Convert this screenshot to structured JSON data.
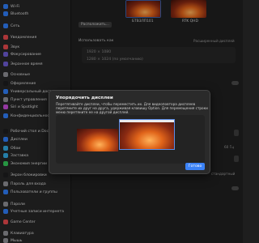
{
  "sidebar": {
    "items": [
      {
        "label": "Wi-Fi",
        "color": "#2f7cf6"
      },
      {
        "label": "Bluetooth",
        "color": "#2f7cf6"
      },
      {
        "label": "Сеть",
        "color": "#2f7cf6"
      },
      {
        "label": "Уведомления",
        "color": "#e5484d"
      },
      {
        "label": "Звук",
        "color": "#e5484d"
      },
      {
        "label": "Фокусирование",
        "color": "#6d5bd0"
      },
      {
        "label": "Экранное время",
        "color": "#6d5bd0"
      },
      {
        "label": "Основные",
        "color": "#8e8e93"
      },
      {
        "label": "Оформление",
        "color": "#1c1c1e"
      },
      {
        "label": "Универсальный доступ",
        "color": "#2f7cf6"
      },
      {
        "label": "Пункт управления",
        "color": "#8e8e93"
      },
      {
        "label": "Siri и Spotlight",
        "color": "#c64bd8"
      },
      {
        "label": "Конфиденциальность",
        "color": "#2f7cf6"
      },
      {
        "label": "Рабочий стол и Dock",
        "color": "#1c1c1e"
      },
      {
        "label": "Дисплеи",
        "color": "#2f7cf6"
      },
      {
        "label": "Обои",
        "color": "#32a8e0"
      },
      {
        "label": "Заставка",
        "color": "#32a8e0"
      },
      {
        "label": "Экономия энергии",
        "color": "#34c759"
      },
      {
        "label": "Экран блокировки",
        "color": "#1c1c1e"
      },
      {
        "label": "Пароль для входа",
        "color": "#8e8e93"
      },
      {
        "label": "Пользователи и группы",
        "color": "#2f7cf6"
      },
      {
        "label": "Пароли",
        "color": "#8e8e93"
      },
      {
        "label": "Учетные записи интернета",
        "color": "#2f7cf6"
      },
      {
        "label": "Game Center",
        "color": "#e5484d"
      },
      {
        "label": "Клавиатура",
        "color": "#8e8e93"
      },
      {
        "label": "Мышь",
        "color": "#8e8e93"
      }
    ]
  },
  "main": {
    "monitor_left_name": "БТВ3ЛП101",
    "monitor_right_name": "RTK QHD",
    "arrange_button": "Расположить...",
    "use_as_label": "Использовать как",
    "use_as_value": "Расширенный дисплей",
    "res_1": "1920 × 1080",
    "res_2": "1280 × 1024 (по умолчанию)",
    "val_frequency": "60 Гц",
    "val_standard": "стандартный"
  },
  "dialog": {
    "title": "Упорядочить дисплеи",
    "description": "Перетягивайте дисплеи, чтобы переместить их. Для видеоповтора дисплеев перетяните их друг на друга, удерживая клавишу Option. Для перемещения строки меню перетяните ее на другой дисплей.",
    "done_label": "Готово"
  }
}
